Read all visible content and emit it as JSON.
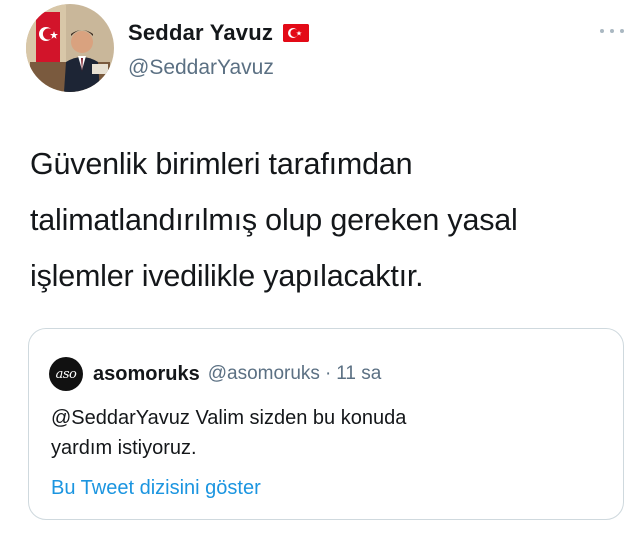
{
  "tweet": {
    "author_name": "Seddar Yavuz",
    "author_flag_icon": "turkey-flag-emoji",
    "author_handle": "@SeddarYavuz",
    "more_icon": "ellipsis-icon",
    "text_lines": [
      "Güvenlik birimleri tarafımdan",
      "talimatlandırılmış olup gereken yasal",
      "işlemler ivedilikle yapılacaktır."
    ]
  },
  "quoted_tweet": {
    "avatar_text": "aso",
    "author_name": "asomoruks",
    "author_handle": "@asomoruks",
    "separator": "·",
    "time": "11 sa",
    "body_lines": [
      "@SeddarYavuz Valim sizden bu konuda",
      "yardım istiyoruz."
    ],
    "thread_link": "Bu Tweet dizisini göster"
  },
  "colors": {
    "text": "#14171a",
    "secondary": "#5b7083",
    "link": "#1b95e0",
    "border": "#cfd9de",
    "flag_red": "#e30a17"
  }
}
